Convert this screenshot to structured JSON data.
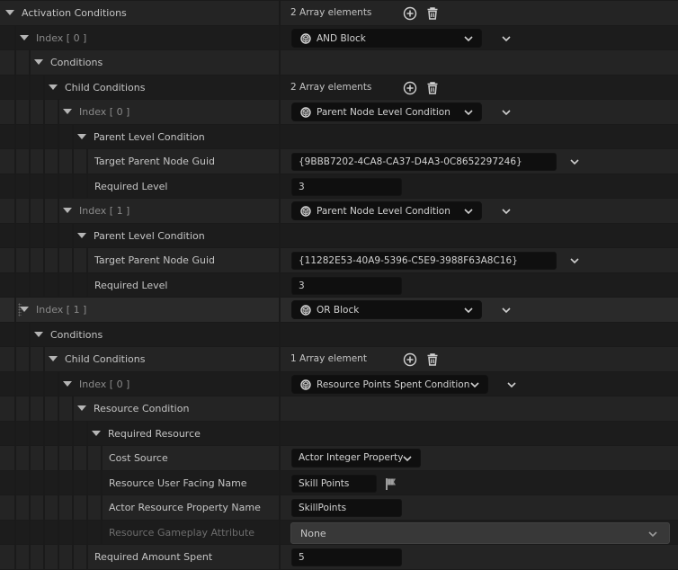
{
  "rows": [
    {
      "name": "Activation Conditions",
      "count": "2 Array elements"
    },
    {
      "name": "Index [ 0 ]",
      "value": "AND Block"
    },
    {
      "name": "Conditions"
    },
    {
      "name": "Child Conditions",
      "count": "2 Array elements"
    },
    {
      "name": "Index [ 0 ]",
      "value": "Parent Node Level Condition"
    },
    {
      "name": "Parent Level Condition"
    },
    {
      "name": "Target Parent Node Guid",
      "value": "{9BBB7202-4CA8-CA37-D4A3-0C8652297246}"
    },
    {
      "name": "Required Level",
      "value": "3"
    },
    {
      "name": "Index [ 1 ]",
      "value": "Parent Node Level Condition"
    },
    {
      "name": "Parent Level Condition"
    },
    {
      "name": "Target Parent Node Guid",
      "value": "{11282E53-40A9-5396-C5E9-3988F63A8C16}"
    },
    {
      "name": "Required Level",
      "value": "3"
    },
    {
      "name": "Index [ 1 ]",
      "value": "OR Block"
    },
    {
      "name": "Conditions"
    },
    {
      "name": "Child Conditions",
      "count": "1 Array element"
    },
    {
      "name": "Index [ 0 ]",
      "value": "Resource Points Spent Condition"
    },
    {
      "name": "Resource Condition"
    },
    {
      "name": "Required Resource"
    },
    {
      "name": "Cost Source",
      "value": "Actor Integer Property"
    },
    {
      "name": "Resource User Facing Name",
      "value": "Skill Points"
    },
    {
      "name": "Actor Resource Property Name",
      "value": "SkillPoints"
    },
    {
      "name": "Resource Gameplay Attribute",
      "value": "None"
    },
    {
      "name": "Required Amount Spent",
      "value": "5"
    }
  ],
  "icons": {
    "add": "add-element-icon",
    "delete": "delete-icon",
    "class": "class-icon",
    "chevron": "chevron-down-icon",
    "flag": "flag-icon",
    "expand": "expand-arrow-icon"
  },
  "colors": {
    "background": "#1a1a1a",
    "row": "#242424",
    "input": "#0f0f0f",
    "text": "#c4c4c4",
    "index_text": "#8a8a8a"
  }
}
